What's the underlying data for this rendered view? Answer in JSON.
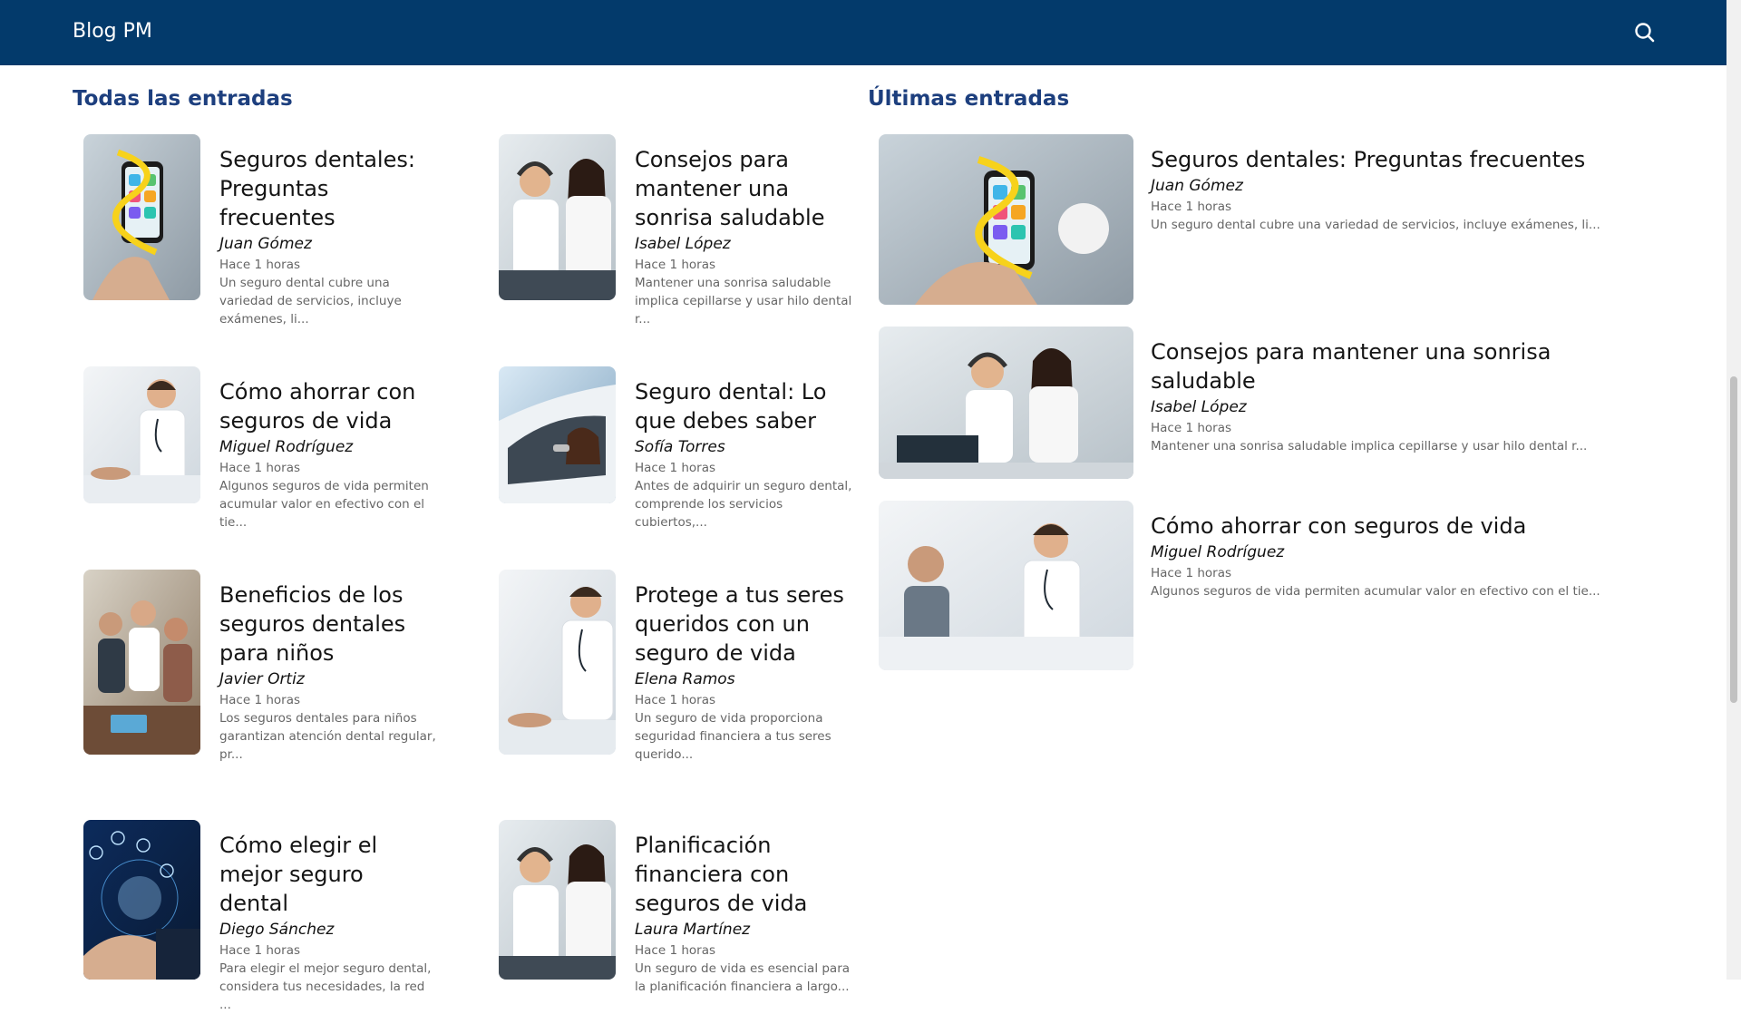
{
  "header": {
    "brand": "Blog PM",
    "search_icon": "search-icon"
  },
  "all_posts": {
    "heading": "Todas las entradas",
    "posts": [
      {
        "title": "Seguros dentales: Preguntas frecuentes",
        "author": "Juan Gómez",
        "time": "Hace 1 horas",
        "excerpt": "Un seguro dental cubre una variedad de servicios, incluye exámenes, li..."
      },
      {
        "title": "Consejos para mantener una sonrisa saludable",
        "author": "Isabel López",
        "time": "Hace 1 horas",
        "excerpt": "Mantener una sonrisa saludable implica cepillarse y usar hilo dental r..."
      },
      {
        "title": "Cómo ahorrar con seguros de vida",
        "author": "Miguel Rodríguez",
        "time": "Hace 1 horas",
        "excerpt": "Algunos seguros de vida permiten acumular valor en efectivo con el tie..."
      },
      {
        "title": "Seguro dental: Lo que debes saber",
        "author": "Sofía Torres",
        "time": "Hace 1 horas",
        "excerpt": "Antes de adquirir un seguro dental, comprende los servicios cubiertos,..."
      },
      {
        "title": "Beneficios de los seguros dentales para niños",
        "author": "Javier Ortiz",
        "time": "Hace 1 horas",
        "excerpt": "Los seguros dentales para niños garantizan atención dental regular, pr..."
      },
      {
        "title": "Protege a tus seres queridos con un seguro de vida",
        "author": "Elena Ramos",
        "time": "Hace 1 horas",
        "excerpt": "Un seguro de vida proporciona seguridad financiera a tus seres querido..."
      },
      {
        "title": "Cómo elegir el mejor seguro dental",
        "author": "Diego Sánchez",
        "time": "Hace 1 horas",
        "excerpt": "Para elegir el mejor seguro dental, considera tus necesidades, la red ..."
      },
      {
        "title": "Planificación financiera con seguros de vida",
        "author": "Laura Martínez",
        "time": "Hace 1 horas",
        "excerpt": "Un seguro de vida es esencial para la planificación financiera a largo..."
      }
    ]
  },
  "latest_posts": {
    "heading": "Últimas entradas",
    "posts": [
      {
        "title": "Seguros dentales: Preguntas frecuentes",
        "author": "Juan Gómez",
        "time": "Hace 1 horas",
        "excerpt": "Un seguro dental cubre una variedad de servicios, incluye exámenes, li..."
      },
      {
        "title": "Consejos para mantener una sonrisa saludable",
        "author": "Isabel López",
        "time": "Hace 1 horas",
        "excerpt": "Mantener una sonrisa saludable implica cepillarse y usar hilo dental r..."
      },
      {
        "title": "Cómo ahorrar con seguros de vida",
        "author": "Miguel Rodríguez",
        "time": "Hace 1 horas",
        "excerpt": "Algunos seguros de vida permiten acumular valor en efectivo con el tie..."
      }
    ]
  },
  "colors": {
    "header_bg": "#033a6b",
    "heading": "#1d3f7e",
    "meta_text": "#666666"
  }
}
